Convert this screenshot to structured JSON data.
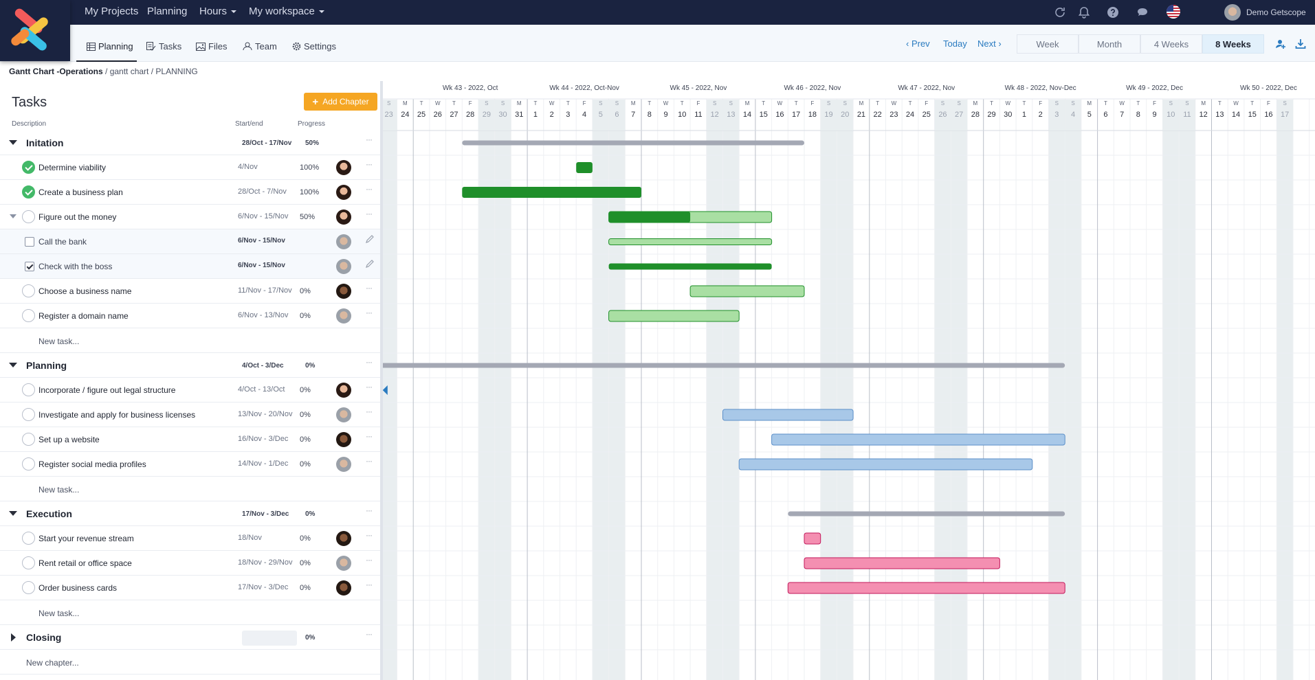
{
  "topnav": {
    "links": [
      "My Projects",
      "Planning",
      "Hours",
      "My workspace"
    ],
    "user": "Demo Getscope"
  },
  "subnav": {
    "tabs": [
      "Planning",
      "Tasks",
      "Files",
      "Team",
      "Settings"
    ],
    "prev": "Prev",
    "today": "Today",
    "next": "Next",
    "periods": [
      "Week",
      "Month",
      "4 Weeks",
      "8 Weeks"
    ],
    "active_period": "8 Weeks"
  },
  "breadcrumb": {
    "project": "Gantt Chart -Operations",
    "rest": " / gantt chart / PLANNING"
  },
  "tasks_panel": {
    "title": "Tasks",
    "add_chapter": "Add Chapter",
    "col_description": "Description",
    "col_startend": "Start/end",
    "col_progress": "Progress",
    "new_task": "New task...",
    "new_chapter": "New chapter..."
  },
  "chapters": [
    {
      "name": "Initation",
      "dates": "28/Oct - 17/Nov",
      "progress": "50%",
      "color": "#1f8f2a",
      "tasks": [
        {
          "name": "Determine viability",
          "dates": "4/Nov",
          "progress": "100%",
          "status": "done",
          "avatar": "a"
        },
        {
          "name": "Create a business plan",
          "dates": "28/Oct - 7/Nov",
          "progress": "100%",
          "status": "done",
          "avatar": "a"
        },
        {
          "name": "Figure out the money",
          "dates": "6/Nov - 15/Nov",
          "progress": "50%",
          "status": "open",
          "avatar": "a",
          "expanded": true,
          "subtasks": [
            {
              "name": "Call the bank",
              "dates": "6/Nov - 15/Nov",
              "checked": false,
              "avatar": "b"
            },
            {
              "name": "Check with the boss",
              "dates": "6/Nov - 15/Nov",
              "checked": true,
              "avatar": "b"
            }
          ]
        },
        {
          "name": "Choose a business name",
          "dates": "11/Nov - 17/Nov",
          "progress": "0%",
          "status": "open",
          "avatar": "c"
        },
        {
          "name": "Register a domain name",
          "dates": "6/Nov - 13/Nov",
          "progress": "0%",
          "status": "open",
          "avatar": "b"
        }
      ]
    },
    {
      "name": "Planning",
      "dates": "4/Oct - 3/Dec",
      "progress": "0%",
      "color": "#a8c8e8",
      "tasks": [
        {
          "name": "Incorporate / figure out legal structure",
          "dates": "4/Oct - 13/Oct",
          "progress": "0%",
          "status": "open",
          "avatar": "a"
        },
        {
          "name": "Investigate and apply for business licenses",
          "dates": "13/Nov - 20/Nov",
          "progress": "0%",
          "status": "open",
          "avatar": "b"
        },
        {
          "name": "Set up a website",
          "dates": "16/Nov - 3/Dec",
          "progress": "0%",
          "status": "open",
          "avatar": "c"
        },
        {
          "name": "Register social media profiles",
          "dates": "14/Nov - 1/Dec",
          "progress": "0%",
          "status": "open",
          "avatar": "b"
        }
      ]
    },
    {
      "name": "Execution",
      "dates": "17/Nov - 3/Dec",
      "progress": "0%",
      "color": "#f48fb1",
      "tasks": [
        {
          "name": "Start your revenue stream",
          "dates": "18/Nov",
          "progress": "0%",
          "status": "open",
          "avatar": "c"
        },
        {
          "name": "Rent retail or office space",
          "dates": "18/Nov - 29/Nov",
          "progress": "0%",
          "status": "open",
          "avatar": "b"
        },
        {
          "name": "Order business cards",
          "dates": "17/Nov - 3/Dec",
          "progress": "0%",
          "status": "open",
          "avatar": "c"
        }
      ]
    },
    {
      "name": "Closing",
      "dates": "",
      "progress": "0%",
      "collapsed": true,
      "tasks": []
    }
  ],
  "timeline": {
    "weeks": [
      "Wk 43 - 2022, Oct",
      "Wk 44 - 2022, Oct-Nov",
      "Wk 45 - 2022, Nov",
      "Wk 46 - 2022, Nov",
      "Wk 47 - 2022, Nov",
      "Wk 48 - 2022, Nov-Dec",
      "Wk 49 - 2022, Dec",
      "Wk 50 - 2022, Dec"
    ],
    "weekday_letters": [
      "M",
      "T",
      "W",
      "T",
      "F",
      "S",
      "S"
    ],
    "days": [
      "23",
      "24",
      "25",
      "26",
      "27",
      "28",
      "29",
      "30",
      "31",
      "1",
      "2",
      "3",
      "4",
      "5",
      "6",
      "7",
      "8",
      "9",
      "10",
      "11",
      "12",
      "13",
      "14",
      "15",
      "16",
      "17",
      "18",
      "19",
      "20",
      "21",
      "22",
      "23",
      "24",
      "25",
      "26",
      "27",
      "28",
      "29",
      "30",
      "1",
      "2",
      "3",
      "4",
      "5",
      "6",
      "7",
      "8",
      "9",
      "10",
      "11",
      "12",
      "13",
      "14",
      "15",
      "16",
      "17"
    ],
    "first_day_weekday_index": 6,
    "colors": {
      "done": "#1f8f2a",
      "done_light": "#a9dfa3",
      "planning": "#a8c8e8",
      "execution": "#f48fb1",
      "chapter": "#a4a8b4",
      "weekend": "#e9eef0"
    }
  },
  "gantt_bars": [
    {
      "row": 0,
      "start": 5,
      "end": 25,
      "kind": "chapter"
    },
    {
      "row": 1,
      "start": 12,
      "end": 12,
      "kind": "done"
    },
    {
      "row": 2,
      "start": 5,
      "end": 15,
      "kind": "done"
    },
    {
      "row": 3,
      "start": 14,
      "end": 23,
      "kind": "partial",
      "progress": 0.5
    },
    {
      "row": 4,
      "start": 14,
      "end": 23,
      "kind": "light"
    },
    {
      "row": 5,
      "start": 14,
      "end": 23,
      "kind": "done"
    },
    {
      "row": 6,
      "start": 19,
      "end": 25,
      "kind": "light"
    },
    {
      "row": 7,
      "start": 14,
      "end": 21,
      "kind": "light"
    },
    {
      "row": 9,
      "start": 0,
      "end": 41,
      "kind": "chapter"
    },
    {
      "row": 10,
      "start": 0,
      "end": 0,
      "kind": "offscreen"
    },
    {
      "row": 11,
      "start": 21,
      "end": 28,
      "kind": "planning"
    },
    {
      "row": 12,
      "start": 24,
      "end": 41,
      "kind": "planning"
    },
    {
      "row": 13,
      "start": 22,
      "end": 39,
      "kind": "planning"
    },
    {
      "row": 15,
      "start": 25,
      "end": 41,
      "kind": "chapter"
    },
    {
      "row": 16,
      "start": 26,
      "end": 26,
      "kind": "execution"
    },
    {
      "row": 17,
      "start": 26,
      "end": 37,
      "kind": "execution"
    },
    {
      "row": 18,
      "start": 25,
      "end": 41,
      "kind": "execution"
    }
  ]
}
